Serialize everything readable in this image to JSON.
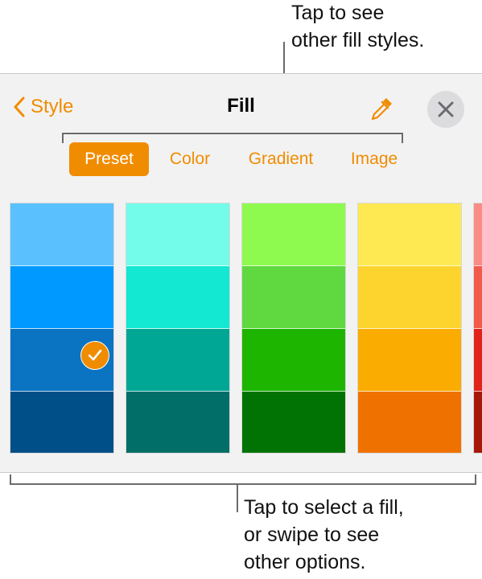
{
  "callouts": {
    "top": [
      "Tap to see",
      "other fill styles."
    ],
    "bottom": [
      "Tap to select a fill,",
      "or swipe to see",
      "other options."
    ]
  },
  "header": {
    "back_label": "Style",
    "title": "Fill",
    "back_icon": "chevron-left-icon",
    "dropper_icon": "eyedropper-icon",
    "close_icon": "close-icon"
  },
  "tabs": [
    {
      "label": "Preset",
      "active": true
    },
    {
      "label": "Color",
      "active": false
    },
    {
      "label": "Gradient",
      "active": false
    },
    {
      "label": "Image",
      "active": false
    }
  ],
  "accent_color": "#f08c00",
  "swatch_columns": [
    {
      "name": "blue",
      "colors": [
        "#5ac1fe",
        "#0099ff",
        "#0a73c2",
        "#004f88"
      ]
    },
    {
      "name": "teal",
      "colors": [
        "#73fce9",
        "#13e8d2",
        "#00a795",
        "#016e67"
      ]
    },
    {
      "name": "green",
      "colors": [
        "#8efa50",
        "#60d83f",
        "#1db500",
        "#007304"
      ]
    },
    {
      "name": "yellow",
      "colors": [
        "#fee952",
        "#fdd42e",
        "#fbac00",
        "#ef7200"
      ]
    },
    {
      "name": "red",
      "colors": [
        "#f98c84",
        "#f25a4b",
        "#e0241b",
        "#a5180a"
      ]
    }
  ],
  "selected_swatch": {
    "column": 0,
    "row": 2
  }
}
